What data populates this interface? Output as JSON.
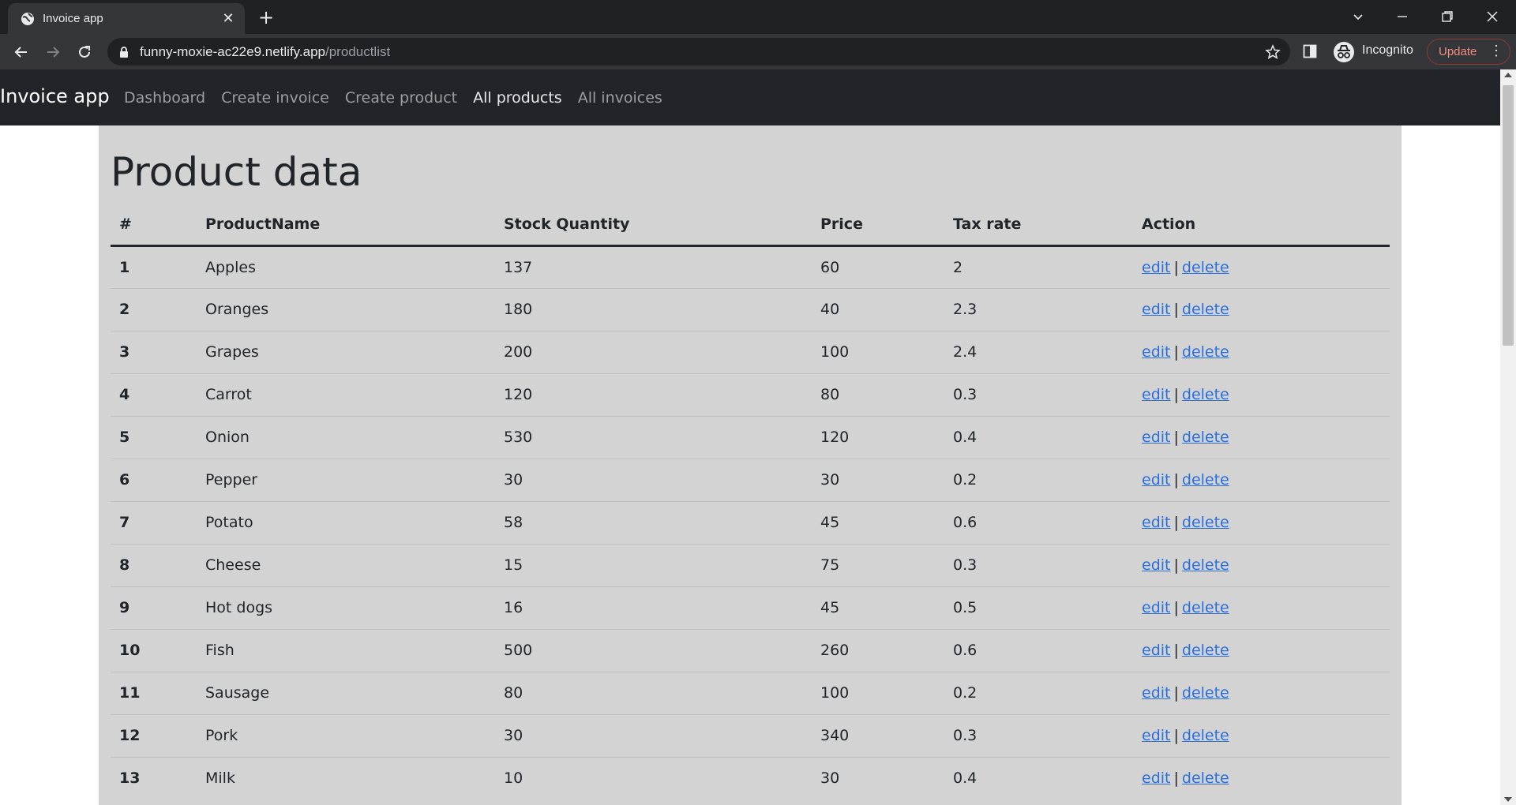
{
  "browser": {
    "tab_title": "Invoice app",
    "url_host": "funny-moxie-ac22e9.netlify.app",
    "url_path": "/productlist",
    "incognito_label": "Incognito",
    "update_label": "Update"
  },
  "navbar": {
    "brand": "Invoice app",
    "links": [
      {
        "label": "Dashboard"
      },
      {
        "label": "Create invoice"
      },
      {
        "label": "Create product"
      },
      {
        "label": "All products"
      },
      {
        "label": "All invoices"
      }
    ]
  },
  "main": {
    "heading": "Product data",
    "columns": [
      "#",
      "ProductName",
      "Stock Quantity",
      "Price",
      "Tax rate",
      "Action"
    ],
    "edit_label": "edit",
    "separator": "|",
    "delete_label": "delete",
    "rows": [
      {
        "id": "1",
        "name": "Apples",
        "stock": "137",
        "price": "60",
        "tax": "2"
      },
      {
        "id": "2",
        "name": "Oranges",
        "stock": "180",
        "price": "40",
        "tax": "2.3"
      },
      {
        "id": "3",
        "name": "Grapes",
        "stock": "200",
        "price": "100",
        "tax": "2.4"
      },
      {
        "id": "4",
        "name": "Carrot",
        "stock": "120",
        "price": "80",
        "tax": "0.3"
      },
      {
        "id": "5",
        "name": "Onion",
        "stock": "530",
        "price": "120",
        "tax": "0.4"
      },
      {
        "id": "6",
        "name": "Pepper",
        "stock": "30",
        "price": "30",
        "tax": "0.2"
      },
      {
        "id": "7",
        "name": "Potato",
        "stock": "58",
        "price": "45",
        "tax": "0.6"
      },
      {
        "id": "8",
        "name": "Cheese",
        "stock": "15",
        "price": "75",
        "tax": "0.3"
      },
      {
        "id": "9",
        "name": "Hot dogs",
        "stock": "16",
        "price": "45",
        "tax": "0.5"
      },
      {
        "id": "10",
        "name": "Fish",
        "stock": "500",
        "price": "260",
        "tax": "0.6"
      },
      {
        "id": "11",
        "name": "Sausage",
        "stock": "80",
        "price": "100",
        "tax": "0.2"
      },
      {
        "id": "12",
        "name": "Pork",
        "stock": "30",
        "price": "340",
        "tax": "0.3"
      },
      {
        "id": "13",
        "name": "Milk",
        "stock": "10",
        "price": "30",
        "tax": "0.4"
      }
    ]
  }
}
